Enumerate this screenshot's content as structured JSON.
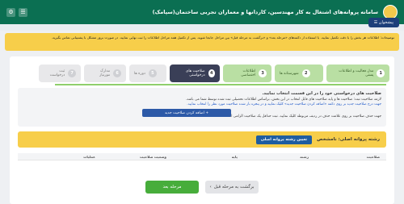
{
  "header": {
    "title": "سامانه پروانه‌های اشتغال به کار مهندسین، کاردانها و معماران تجربی ساختمان(سپامک)",
    "dashboard_label": "پیشخوان"
  },
  "notice": {
    "text": "توضیحات: اطلاعات هر بخش را با دقت تکمیل نمایید. با استفاده از دکمه‌های «مرحله بعد» و «برگشت به مرحله قبل» بین مراحل جابجا شوید. پس از تکمیل همه مراحل اطلاعات را ثبت نهایی نمایید. در صورت بروز مشکل با پشتیبانی تماس بگیرید."
  },
  "tabs": [
    {
      "num": "1",
      "label": "مدل فعالیت و اطلاعات پستی"
    },
    {
      "num": "2",
      "label": "شهرستانه ها"
    },
    {
      "num": "3",
      "label": "اطلاعات اختصاصی"
    },
    {
      "num": "4",
      "label": "صلاحیت های درخواستی"
    },
    {
      "num": "5",
      "label": "دوره ها"
    },
    {
      "num": "6",
      "label": "مدارک مورنیاز"
    },
    {
      "num": "7",
      "label": "ثبت درخواست"
    }
  ],
  "info": {
    "heading": "صلاحیت های درخواستی خود را در این قسمت انتخاب نمایید.",
    "line1": "لازمه صلاحیت ثبت: صلاحیت ها و پایه صلاحیت های قابل انتخاب در این بخش، براساس اطلاعات تحصیلی ثبت شده توسط شما می باشد.",
    "line2": "جهت درج صلاحیت جدید بر روی دکمه «اضافه کردن صلاحیت جدید» کلیک نمایید و در پنجره باز شده صلاحیت مورد نظر را انتخاب نمایید.",
    "line3": "جهت حذف صلاحیت بر روی علامت حذف در ردیف مربوطه کلیک نمایید. ثبت حداقل یک صلاحیت الزامی است.",
    "add_button": "اضافه کردن صلاحیت جدید"
  },
  "section": {
    "title": "رشته پروانه اصلی: نامشخص",
    "determine_button": "تعیین رشته پروانه اصلی"
  },
  "table": {
    "headers": [
      "صلاحیت",
      "رشته",
      "پایه",
      "وضعیت صلاحیت",
      "عملیات"
    ]
  },
  "footer": {
    "next_label": "مرحله بعد",
    "prev_label": "برگشت به مرحله قبل"
  }
}
